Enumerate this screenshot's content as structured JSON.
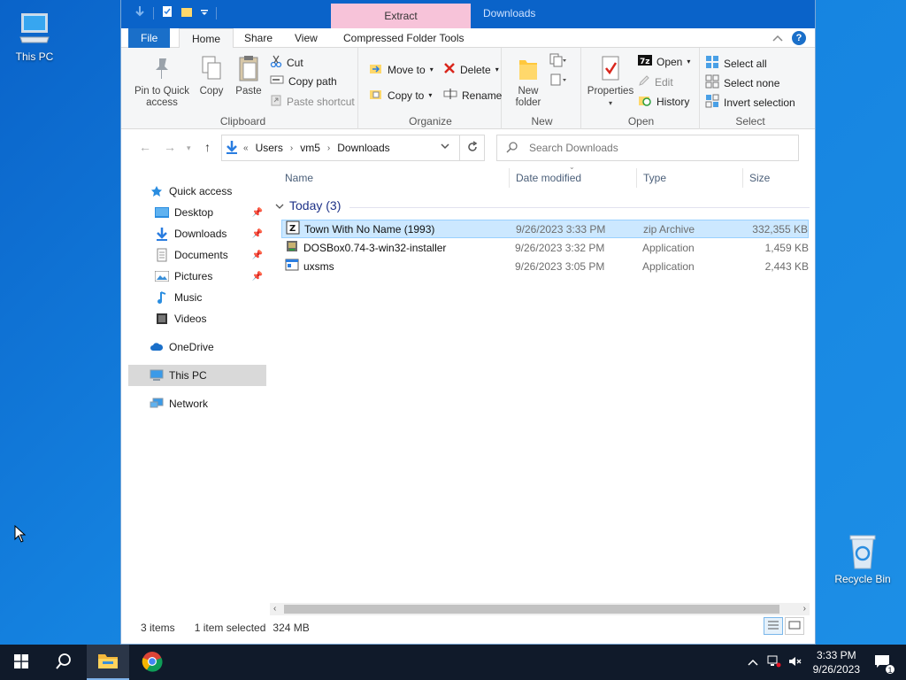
{
  "desktop": {
    "icons": [
      {
        "label": "This PC"
      },
      {
        "label": "Recycle Bin"
      }
    ]
  },
  "window": {
    "title": "Downloads",
    "contextual_tab": "Extract",
    "tabs": [
      "File",
      "Home",
      "Share",
      "View",
      "Compressed Folder Tools"
    ]
  },
  "ribbon": {
    "clipboard": {
      "label": "Clipboard",
      "pin": "Pin to Quick access",
      "copy": "Copy",
      "paste": "Paste",
      "cut": "Cut",
      "copy_path": "Copy path",
      "paste_shortcut": "Paste shortcut"
    },
    "organize": {
      "label": "Organize",
      "move_to": "Move to",
      "copy_to": "Copy to",
      "delete": "Delete",
      "rename": "Rename"
    },
    "new": {
      "label": "New",
      "new_folder": "New folder"
    },
    "open": {
      "label": "Open",
      "properties": "Properties",
      "open": "Open",
      "edit": "Edit",
      "history": "History"
    },
    "select": {
      "label": "Select",
      "select_all": "Select all",
      "select_none": "Select none",
      "invert": "Invert selection"
    }
  },
  "address": {
    "crumbs": [
      "Users",
      "vm5",
      "Downloads"
    ],
    "search_placeholder": "Search Downloads"
  },
  "navpane": {
    "quick_access": "Quick access",
    "items": [
      {
        "label": "Desktop"
      },
      {
        "label": "Downloads"
      },
      {
        "label": "Documents"
      },
      {
        "label": "Pictures"
      },
      {
        "label": "Music"
      },
      {
        "label": "Videos"
      }
    ],
    "onedrive": "OneDrive",
    "this_pc": "This PC",
    "network": "Network"
  },
  "filelist": {
    "columns": {
      "name": "Name",
      "date": "Date modified",
      "type": "Type",
      "size": "Size"
    },
    "group": "Today (3)",
    "rows": [
      {
        "name": "Town With No Name (1993)",
        "date": "9/26/2023 3:33 PM",
        "type": "zip Archive",
        "size": "332,355 KB"
      },
      {
        "name": "DOSBox0.74-3-win32-installer",
        "date": "9/26/2023 3:32 PM",
        "type": "Application",
        "size": "1,459 KB"
      },
      {
        "name": "uxsms",
        "date": "9/26/2023 3:05 PM",
        "type": "Application",
        "size": "2,443 KB"
      }
    ]
  },
  "status": {
    "count": "3 items",
    "selected": "1 item selected",
    "size": "324 MB"
  },
  "taskbar": {
    "time": "3:33 PM",
    "date": "9/26/2023",
    "notification_count": "1"
  }
}
